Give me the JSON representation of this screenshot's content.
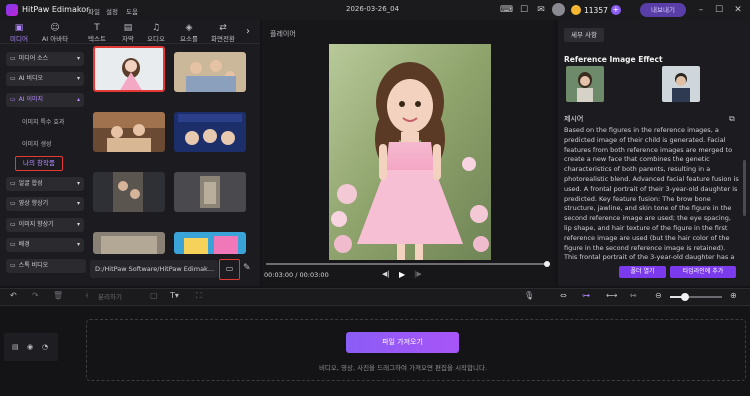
{
  "app": {
    "name": "HitPaw Edimakor",
    "project": "2026-03-26_04",
    "menu": [
      "파일",
      "설정",
      "도움"
    ],
    "credits": "11357",
    "export_label": "내보내기"
  },
  "tabs": [
    {
      "label": "미디어",
      "icon": "media-icon",
      "active": true
    },
    {
      "label": "AI 아바타",
      "icon": "avatar-icon",
      "active": false
    },
    {
      "label": "텍스트",
      "icon": "text-icon",
      "active": false
    },
    {
      "label": "자막",
      "icon": "subtitle-icon",
      "active": false
    },
    {
      "label": "오디오",
      "icon": "audio-icon",
      "active": false
    },
    {
      "label": "요소를",
      "icon": "elements-icon",
      "active": false
    },
    {
      "label": "화면전환",
      "icon": "transition-icon",
      "active": false
    }
  ],
  "sidebar": {
    "items": [
      "미디어 소스",
      "AI 비디오",
      "AI 이미지",
      "얼굴 합성",
      "영상 향상기",
      "이미지 향상기",
      "배경",
      "스톡 비디오"
    ],
    "sub_items": [
      "이미지 특수 효과",
      "이미지 생성"
    ],
    "selected": "나의 창작품"
  },
  "media": {
    "path": "D:/HitPaw Software/HitPaw Edimak..."
  },
  "player": {
    "label": "플레이어",
    "timecode": "00:03:00 / 00:03:00"
  },
  "right_panel": {
    "tab": "세부 사항",
    "reference_title": "Reference Image Effect",
    "prompt_label": "제시어",
    "prompt_text": "Based on the figures in the reference images, a predicted image of their child is generated. Facial features from both reference images are merged to create a new face that combines the genetic characteristics of both parents, resulting in a photorealistic blend. Advanced facial feature fusion is used. A frontal portrait of their 3-year-old daughter is predicted. Key feature fusion: The brow bone structure, jawline, and skin tone of the figure in the second reference image are used; the eye spacing, lip shape, and hair texture of the figure in the first reference image are used (but the hair color of the figure in the second reference image is retained). This frontal portrait of the 3-year-old daughter has a 50% similarity to the figures in each",
    "folder_button": "폴더 열기",
    "timeline_button": "타임라인에 추가"
  },
  "toolbar": {
    "split_label": "분리하기"
  },
  "timeline": {
    "import_label": "파일 가져오기",
    "hint": "비디오, 영상, 사진을 드래그하여 가져오면 편집을 시작합니다."
  }
}
